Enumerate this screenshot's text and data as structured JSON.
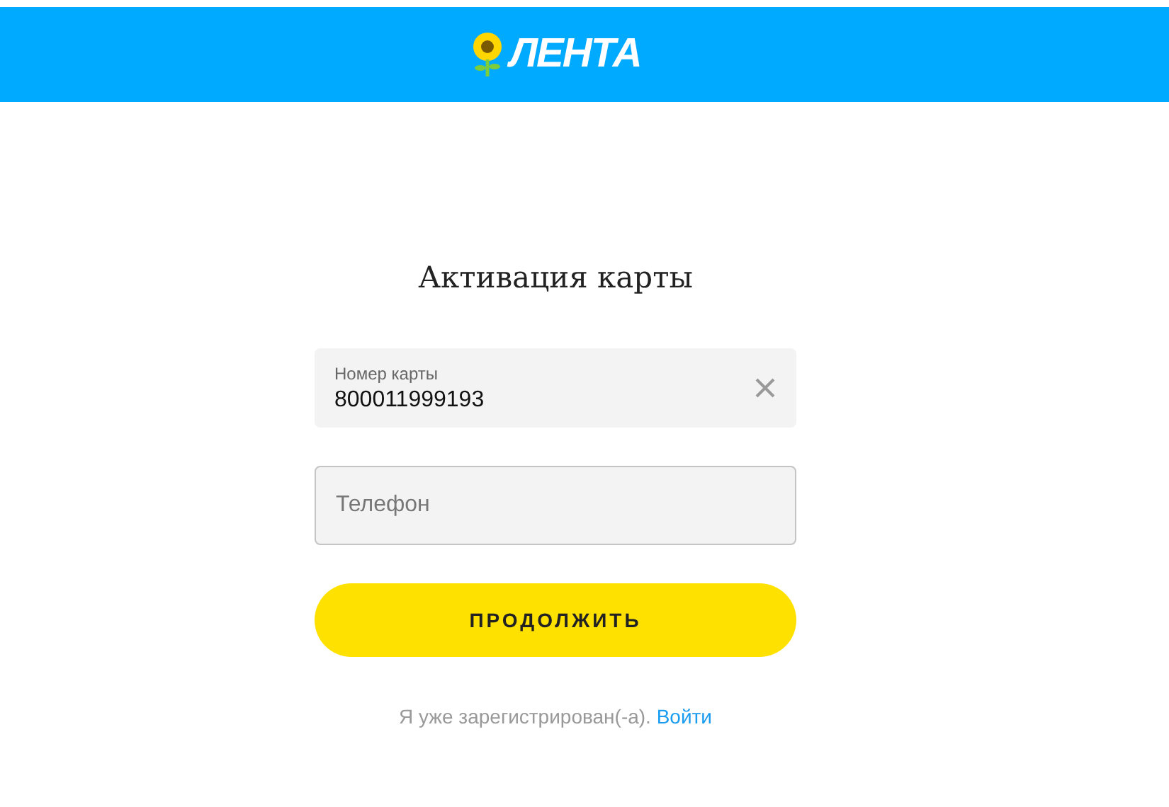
{
  "header": {
    "logo_text": "ЛЕНТА"
  },
  "title": "Активация карты",
  "fields": [
    {
      "label": "Номер карты",
      "value": "800011999193",
      "clearable": true
    },
    {
      "placeholder": "Телефон",
      "clearable": false
    }
  ],
  "submit_button": "ПРОДОЛЖИТЬ",
  "login_prompt": {
    "text": "Я уже зарегистрирован(-а).",
    "link": "Войти"
  }
}
